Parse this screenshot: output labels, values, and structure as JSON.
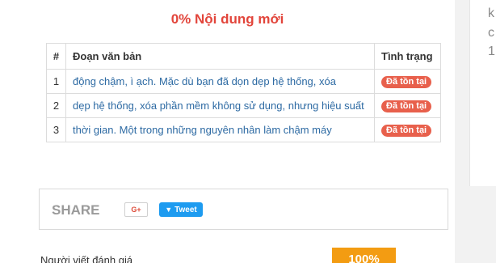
{
  "heading": "0% Nội dung mới",
  "table": {
    "headers": {
      "num": "#",
      "text": "Đoạn văn bản",
      "status": "Tình trạng"
    },
    "rows": [
      {
        "num": "1",
        "text": "động chậm, ì ạch. Mặc dù bạn đã dọn dẹp hệ thống, xóa",
        "status": "Đã tồn tại"
      },
      {
        "num": "2",
        "text": "dẹp hệ thống, xóa phần mềm không sử dụng, nhưng hiệu suất",
        "status": "Đã tồn tại"
      },
      {
        "num": "3",
        "text": "thời gian. Một trong những nguyên nhân làm chậm máy",
        "status": "Đã tồn tại"
      }
    ]
  },
  "share": {
    "label": "SHARE",
    "gplus": "G+",
    "tweet": "Tweet"
  },
  "rating_label": "Người viết đánh giá",
  "score": "100%",
  "side_fragments": [
    "k",
    "c",
    "1"
  ],
  "colors": {
    "heading": "#e2453b",
    "badge": "#e8604c",
    "link": "#2d6aa3",
    "tweet": "#1d9bf0",
    "score": "#f39c12"
  }
}
